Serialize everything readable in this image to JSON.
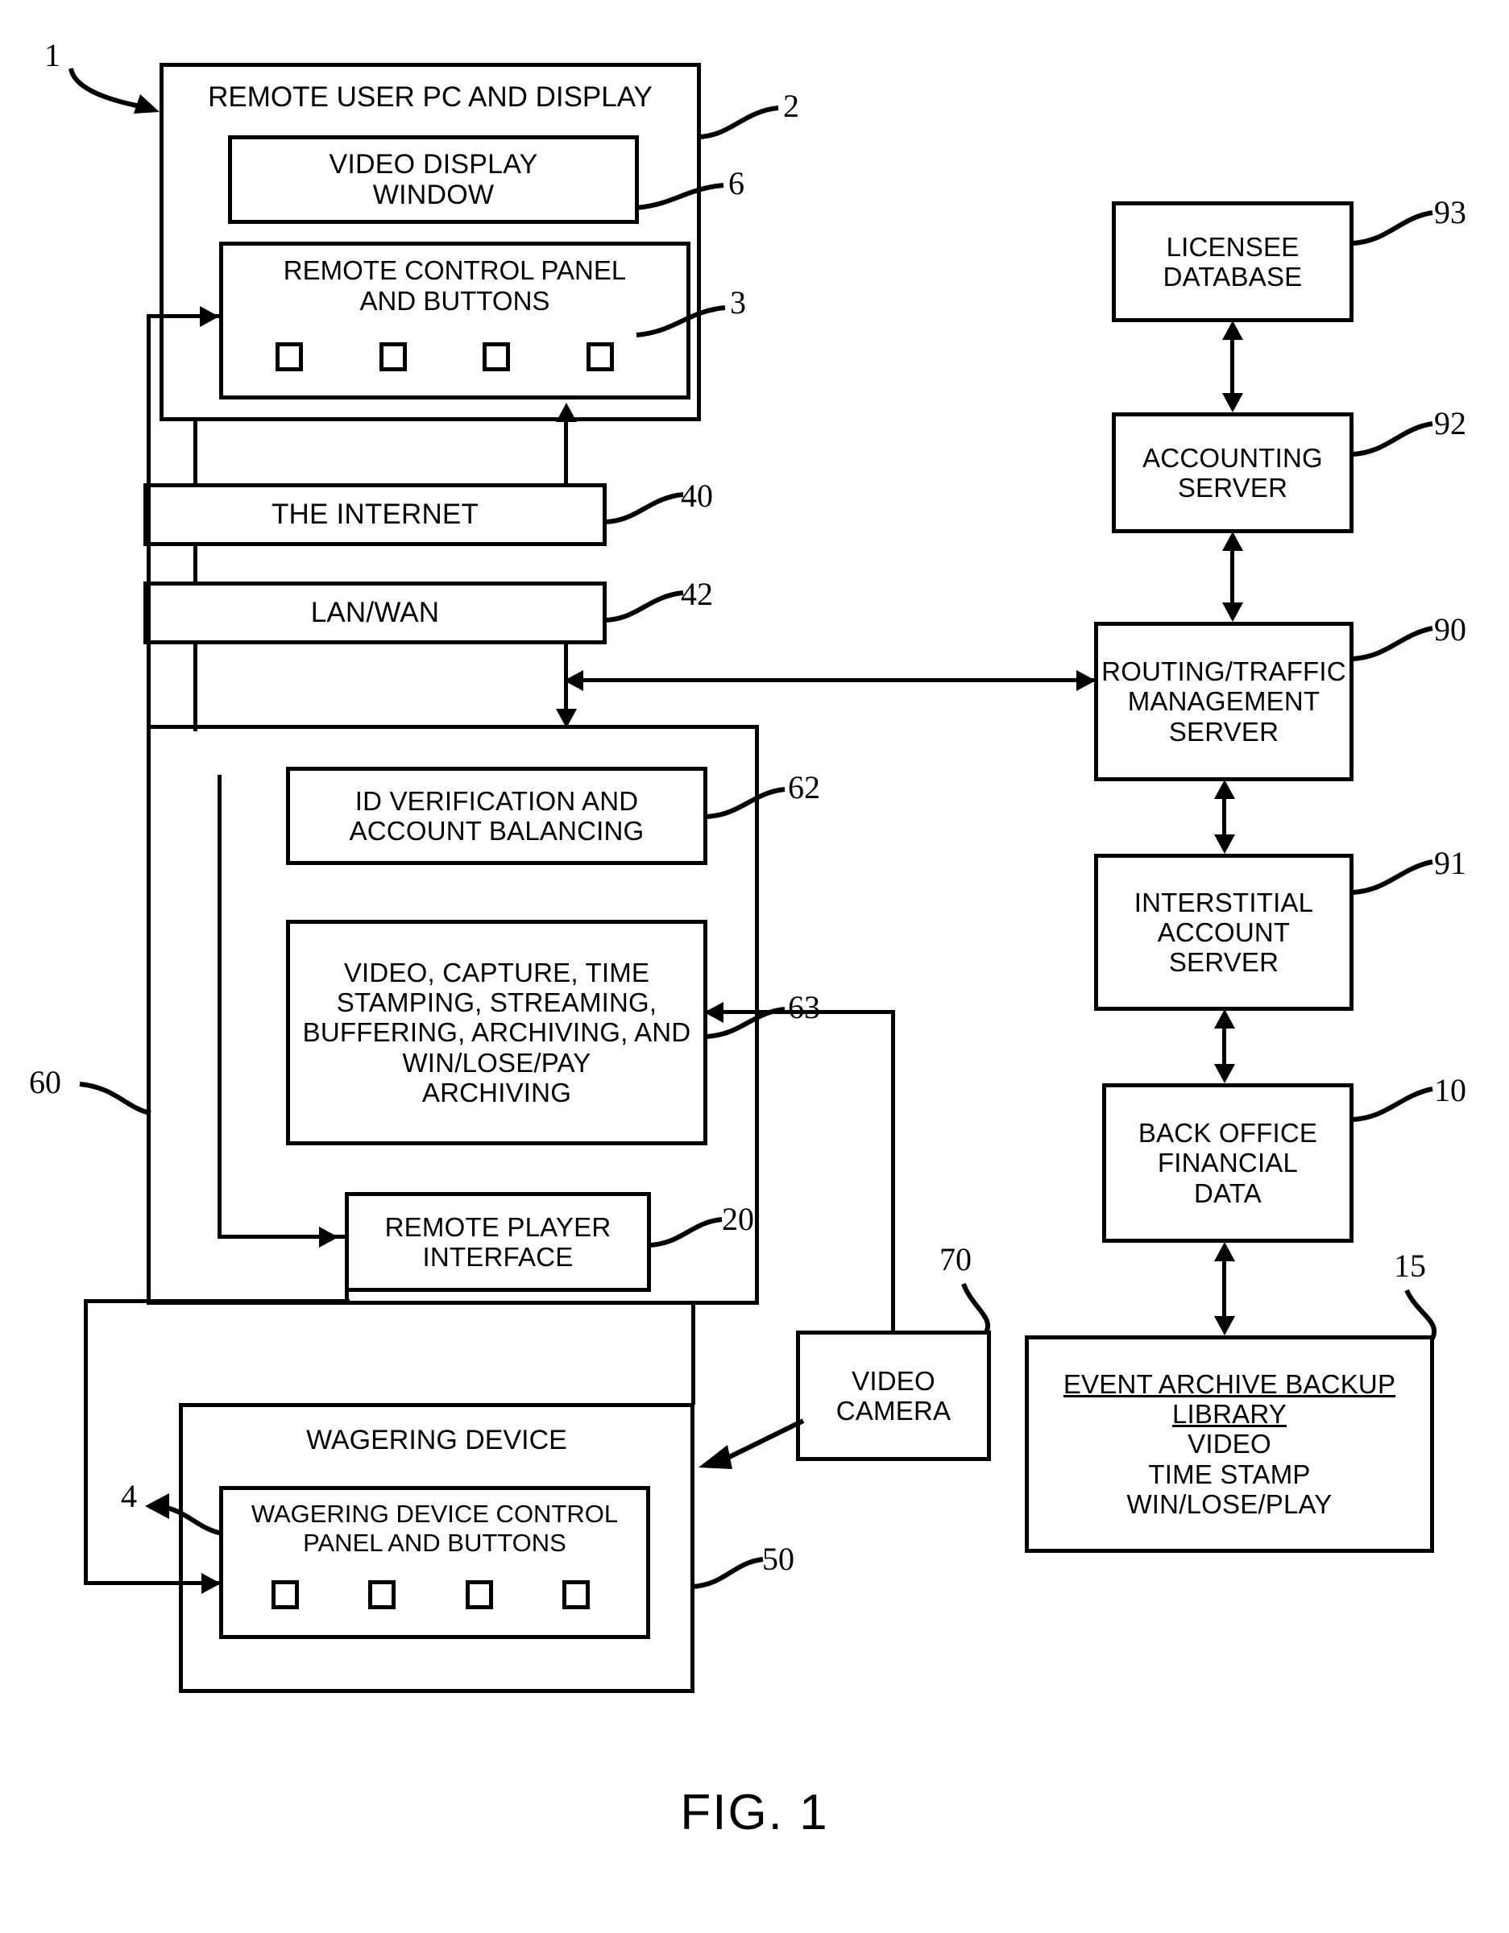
{
  "figure": {
    "caption": "FIG. 1",
    "system_ref": "1"
  },
  "remote_user": {
    "title": "REMOTE USER PC AND DISPLAY",
    "ref": "2",
    "video_display": {
      "line1": "VIDEO DISPLAY",
      "line2": "WINDOW",
      "ref": "6"
    },
    "control_panel": {
      "line1": "REMOTE CONTROL PANEL",
      "line2": "AND BUTTONS",
      "ref": "3",
      "buttons": [
        "button-1",
        "button-2",
        "button-3",
        "button-4"
      ]
    }
  },
  "network": {
    "internet": {
      "label": "THE INTERNET",
      "ref": "40"
    },
    "lanwan": {
      "label": "LAN/WAN",
      "ref": "42"
    }
  },
  "host_system": {
    "ref": "60",
    "id_verification": {
      "line1": "ID VERIFICATION AND",
      "line2": "ACCOUNT BALANCING",
      "ref": "62"
    },
    "video_services": {
      "line1": "VIDEO, CAPTURE, TIME",
      "line2": "STAMPING, STREAMING,",
      "line3": "BUFFERING, ARCHIVING, AND",
      "line4": "WIN/LOSE/PAY",
      "line5": "ARCHIVING",
      "ref": "63"
    },
    "remote_player_interface": {
      "line1": "REMOTE PLAYER",
      "line2": "INTERFACE",
      "ref": "20"
    }
  },
  "wagering": {
    "title": "WAGERING DEVICE",
    "ref": "50",
    "control_panel": {
      "line1": "WAGERING DEVICE CONTROL",
      "line2": "PANEL AND BUTTONS",
      "ref": "4",
      "buttons": [
        "button-1",
        "button-2",
        "button-3",
        "button-4"
      ]
    }
  },
  "video_camera": {
    "line1": "VIDEO",
    "line2": "CAMERA",
    "ref": "70"
  },
  "servers": {
    "licensee_database": {
      "line1": "LICENSEE",
      "line2": "DATABASE",
      "ref": "93"
    },
    "accounting_server": {
      "line1": "ACCOUNTING",
      "line2": "SERVER",
      "ref": "92"
    },
    "routing_server": {
      "line1": "ROUTING/TRAFFIC",
      "line2": "MANAGEMENT",
      "line3": "SERVER",
      "ref": "90"
    },
    "interstitial_server": {
      "line1": "INTERSTITIAL",
      "line2": "ACCOUNT",
      "line3": "SERVER",
      "ref": "91"
    },
    "back_office": {
      "line1": "BACK OFFICE",
      "line2": "FINANCIAL",
      "line3": "DATA",
      "ref": "10"
    },
    "event_archive": {
      "line1": "EVENT ARCHIVE BACKUP",
      "line2": "LIBRARY",
      "line3": "VIDEO",
      "line4": "TIME STAMP",
      "line5": "WIN/LOSE/PLAY",
      "ref": "15"
    }
  },
  "colors": {
    "ink": "#000000",
    "paper": "#ffffff"
  }
}
